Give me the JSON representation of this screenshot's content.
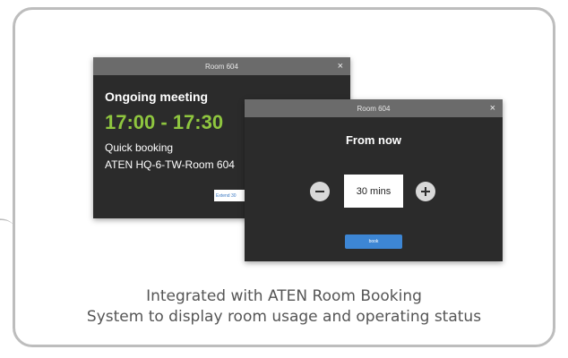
{
  "back_panel": {
    "title": "Room 604",
    "close_glyph": "×",
    "status": "Ongoing meeting",
    "time_range": "17:00 - 17:30",
    "booking_type": "Quick booking",
    "room_name": "ATEN HQ-6-TW-Room 604",
    "extend_label": "Extend 30",
    "time_color": "#8fc63f"
  },
  "front_panel": {
    "title": "Room 604",
    "close_glyph": "×",
    "heading": "From now",
    "minus_icon": "minus-icon",
    "plus_icon": "plus-icon",
    "duration_value": "30 mins",
    "book_label": "book",
    "accent_color": "#3d86d4"
  },
  "caption": {
    "line1": "Integrated with ATEN Room Booking",
    "line2": "System to display room usage and operating status"
  }
}
